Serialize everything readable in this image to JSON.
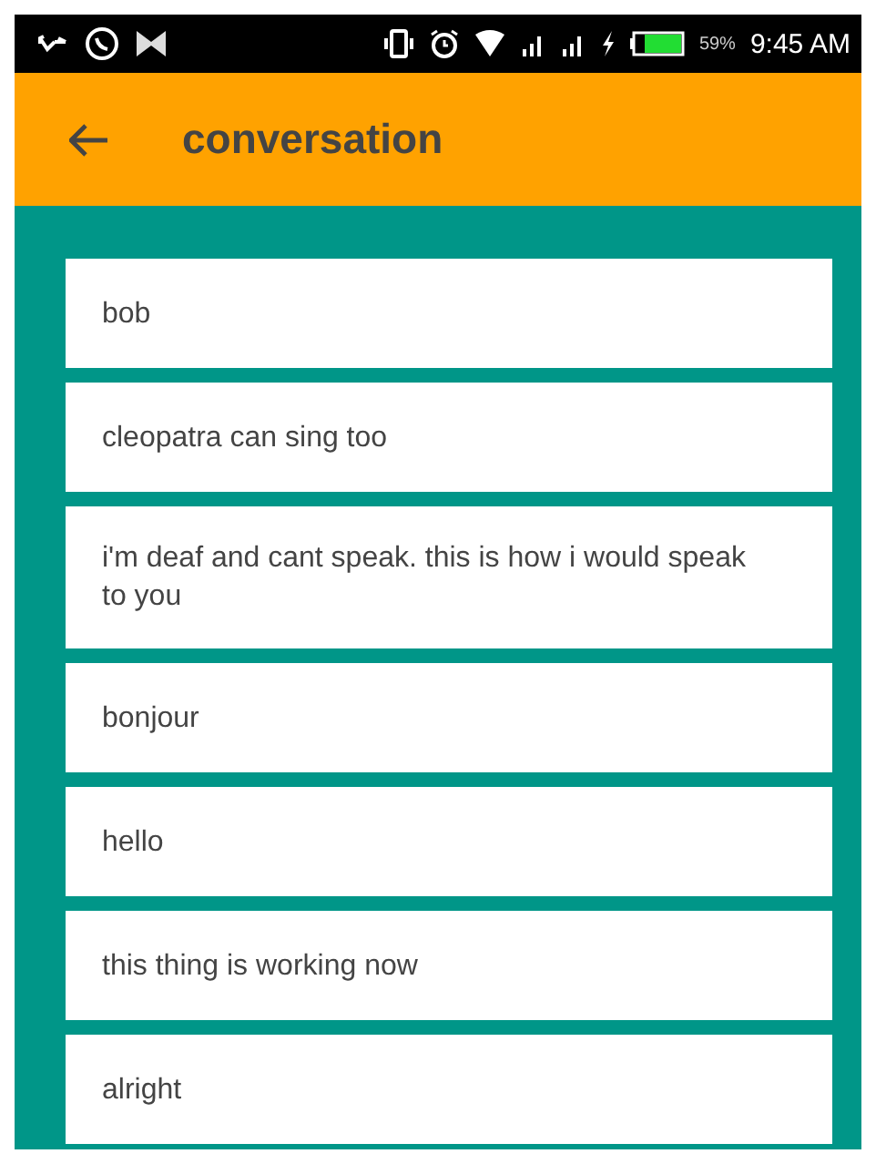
{
  "status_bar": {
    "battery_percent": "59%",
    "time": "9:45 AM"
  },
  "app_bar": {
    "title": "conversation"
  },
  "messages": [
    {
      "text": "bob"
    },
    {
      "text": "cleopatra can sing too"
    },
    {
      "text": "i'm deaf and cant speak. this is how i would speak to you"
    },
    {
      "text": "bonjour"
    },
    {
      "text": "hello"
    },
    {
      "text": "this thing is working now"
    },
    {
      "text": "alright"
    }
  ]
}
